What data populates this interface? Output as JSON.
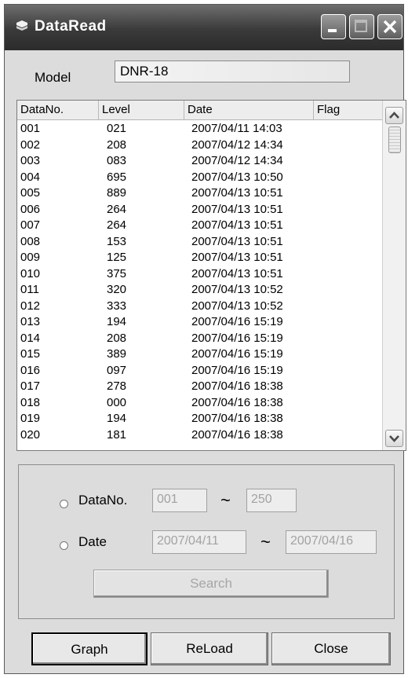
{
  "window": {
    "title": "DataRead",
    "icons": [
      "app-icon",
      "minimize-icon",
      "maximize-icon",
      "close-icon"
    ]
  },
  "model": {
    "label": "Model",
    "value": "DNR-18"
  },
  "table": {
    "columns": [
      "DataNo.",
      "Level",
      "Date",
      "Flag"
    ],
    "rows": [
      [
        "001",
        "021",
        "2007/04/11 14:03"
      ],
      [
        "002",
        "208",
        "2007/04/12 14:34"
      ],
      [
        "003",
        "083",
        "2007/04/12 14:34"
      ],
      [
        "004",
        "695",
        "2007/04/13 10:50"
      ],
      [
        "005",
        "889",
        "2007/04/13 10:51"
      ],
      [
        "006",
        "264",
        "2007/04/13 10:51"
      ],
      [
        "007",
        "264",
        "2007/04/13 10:51"
      ],
      [
        "008",
        "153",
        "2007/04/13 10:51"
      ],
      [
        "009",
        "125",
        "2007/04/13 10:51"
      ],
      [
        "010",
        "375",
        "2007/04/13 10:51"
      ],
      [
        "011",
        "320",
        "2007/04/13 10:52"
      ],
      [
        "012",
        "333",
        "2007/04/13 10:52"
      ],
      [
        "013",
        "194",
        "2007/04/16 15:19"
      ],
      [
        "014",
        "208",
        "2007/04/16 15:19"
      ],
      [
        "015",
        "389",
        "2007/04/16 15:19"
      ],
      [
        "016",
        "097",
        "2007/04/16 15:19"
      ],
      [
        "017",
        "278",
        "2007/04/16 18:38"
      ],
      [
        "018",
        "000",
        "2007/04/16 18:38"
      ],
      [
        "019",
        "194",
        "2007/04/16 18:38"
      ],
      [
        "020",
        "181",
        "2007/04/16 18:38"
      ]
    ]
  },
  "search": {
    "datano_label": "DataNo.",
    "datano_from": "001",
    "datano_to": "250",
    "date_label": "Date",
    "date_from": "2007/04/11",
    "date_to": "2007/04/16",
    "range_sep": "~",
    "search_button": "Search"
  },
  "buttons": {
    "graph": "Graph",
    "reload": "ReLoad",
    "close": "Close"
  }
}
